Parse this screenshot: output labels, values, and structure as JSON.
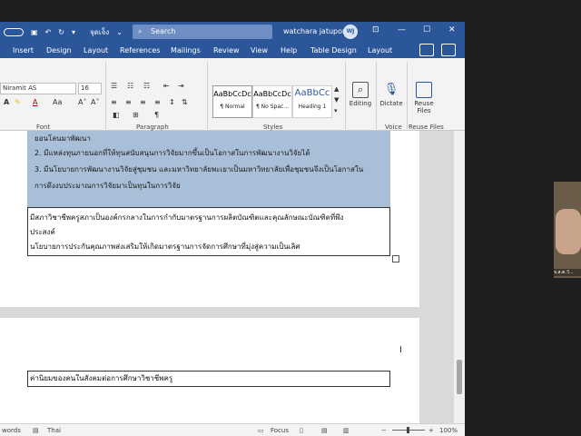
{
  "titlebar": {
    "autosave": "จุดเจ็ง",
    "search_placeholder": "Search",
    "user_name": "watchara jatuporn",
    "user_initials": "WJ"
  },
  "tabs": [
    "Insert",
    "Design",
    "Layout",
    "References",
    "Mailings",
    "Review",
    "View",
    "Help",
    "Table Design",
    "Layout"
  ],
  "ribbon": {
    "font_name": "Niramit AS",
    "font_size": "16",
    "group_labels": {
      "font": "Font",
      "paragraph": "Paragraph",
      "styles": "Styles",
      "voice": "Voice",
      "reuse": "Reuse Files"
    },
    "styles": [
      {
        "preview": "AaBbCcDc",
        "name": "¶ Normal"
      },
      {
        "preview": "AaBbCcDc",
        "name": "¶ No Spac..."
      },
      {
        "preview": "AaBbCc",
        "name": "Heading 1"
      }
    ],
    "editing_label": "Editing",
    "dictate_label": "Dictate",
    "reuse_label_1": "Reuse",
    "reuse_label_2": "Files"
  },
  "document": {
    "selected_lines": [
      "ยอนโลนมาพัฒนา",
      "2. มีแหล่งทุนภายนอกที่ให้ทุนสนับสนุนการวิจัยมากขึ้นเป็นโอกาสในการพัฒนางานวิจัยได้",
      "3. มีนโยบายการพัฒนางานวิจัยสู่ชุมชน และมหาวิทยาลัยพะเยาเป็นมหาวิทยาลัยเพื่อชุมชนจึงเป็นโอกาสใน",
      "การดึงงบประมาณการวิจัยมาเป็นทุนในการวิจัย"
    ],
    "table_lines": [
      "มีสภาวิชาชีพครูสภาเป็นองค์กรกลางในการกำกับมาตรฐานการผลิตบัณฑิตและคุณลักษณะบัณฑิตที่พึง",
      "ประสงค์",
      "นโยบายการประกันคุณภาพส่งเสริมให้เกิดมาตรฐานการจัดการศึกษาที่มุ่งสู่ความเป็นเลิศ"
    ],
    "page2_cell": "ค่านิยมของคนในสังคมต่อการศึกษาวิชาชีพครู"
  },
  "statusbar": {
    "words": "words",
    "language": "Thai",
    "focus": "Focus",
    "zoom": "100%"
  },
  "video": {
    "caption": "จ.ส.ต.วั..."
  },
  "colors": {
    "title_blue": "#2b579a",
    "selection": "#a9bfd8"
  }
}
